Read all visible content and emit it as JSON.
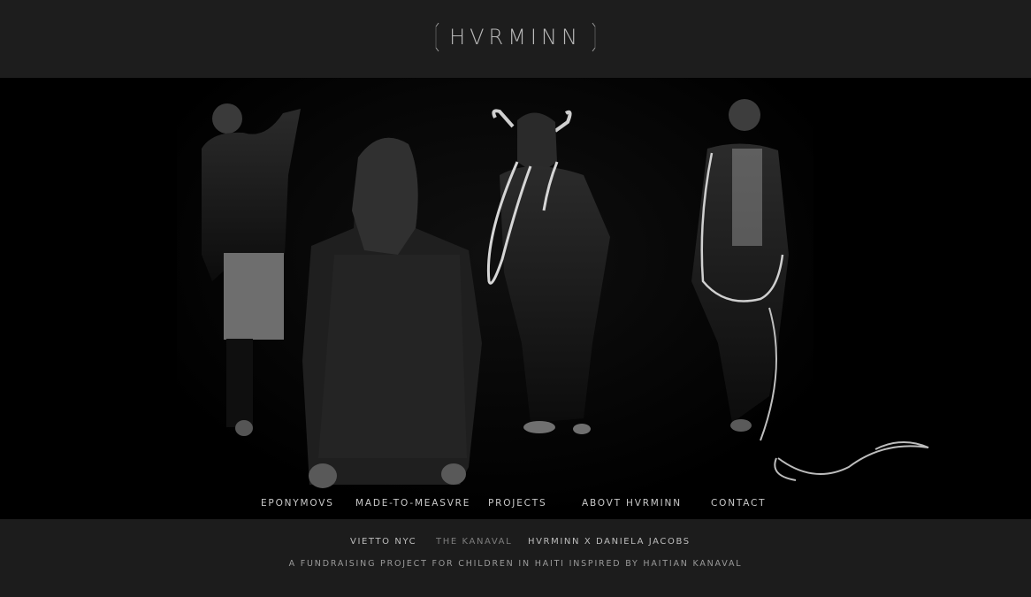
{
  "brand": {
    "logo_text": "HVRMINN"
  },
  "hero": {
    "image_description_icon": "campaign-photo"
  },
  "nav": {
    "items": [
      {
        "label": "EPONYMOVS"
      },
      {
        "label": "MADE-TO-MEASVRE"
      },
      {
        "label": "PROJECTS"
      },
      {
        "label": "ABOVT HVRMINN"
      },
      {
        "label": "CONTACT"
      }
    ]
  },
  "subnav": {
    "items": [
      {
        "label": "VIETTO NYC",
        "active": false
      },
      {
        "label": "THE KANAVAL",
        "active": true
      },
      {
        "label": "HVRMINN X DANIELA JACOBS",
        "active": false
      }
    ]
  },
  "footer": {
    "tagline": "A FUNDRAISING PROJECT FOR CHILDREN IN HAITI INSPIRED BY HAITIAN KANAVAL"
  },
  "colors": {
    "background": "#1c1c1c",
    "hero_background": "#000000",
    "text": "#c9c9c9",
    "active_text": "#7d7d7d"
  }
}
